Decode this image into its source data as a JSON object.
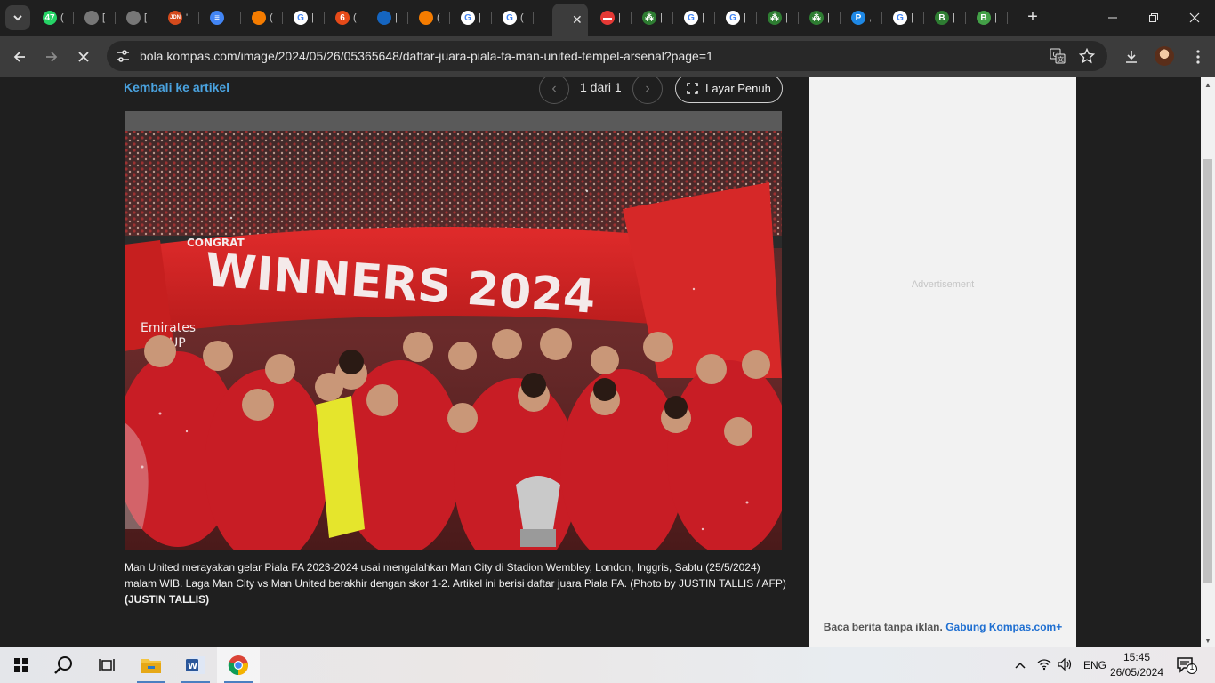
{
  "browser": {
    "tabs": [
      {
        "favicon": "whatsapp",
        "color": "#25d366",
        "glyph": "47",
        "title": "("
      },
      {
        "favicon": "globe",
        "color": "#777777",
        "glyph": "",
        "title": "["
      },
      {
        "favicon": "globe",
        "color": "#777777",
        "glyph": "",
        "title": "["
      },
      {
        "favicon": "news",
        "color": "#d44a1c",
        "glyph": "JDN",
        "title": "'"
      },
      {
        "favicon": "docs",
        "color": "#4285f4",
        "glyph": "≡",
        "title": "|"
      },
      {
        "favicon": "kompas",
        "color": "#f57c00",
        "glyph": "",
        "title": "("
      },
      {
        "favicon": "google",
        "color": "#ffffff",
        "glyph": "G",
        "title": "|"
      },
      {
        "favicon": "six",
        "color": "#e64a19",
        "glyph": "6",
        "title": "("
      },
      {
        "favicon": "bola",
        "color": "#1565c0",
        "glyph": "",
        "title": "|"
      },
      {
        "favicon": "kompas",
        "color": "#f57c00",
        "glyph": "",
        "title": "("
      },
      {
        "favicon": "google",
        "color": "#ffffff",
        "glyph": "G",
        "title": "|"
      },
      {
        "favicon": "google",
        "color": "#ffffff",
        "glyph": "G",
        "title": "("
      }
    ],
    "active_tab": {
      "title": "("
    },
    "tabs_after": [
      {
        "favicon": "badge",
        "color": "#e53935",
        "glyph": "▬",
        "title": "|"
      },
      {
        "favicon": "runner",
        "color": "#2e7d32",
        "glyph": "⁂",
        "title": "|"
      },
      {
        "favicon": "google",
        "color": "#ffffff",
        "glyph": "G",
        "title": "|"
      },
      {
        "favicon": "google",
        "color": "#ffffff",
        "glyph": "G",
        "title": "|"
      },
      {
        "favicon": "runner",
        "color": "#2e7d32",
        "glyph": "⁂",
        "title": "|"
      },
      {
        "favicon": "runner",
        "color": "#2e7d32",
        "glyph": "⁂",
        "title": "|"
      },
      {
        "favicon": "p",
        "color": "#1e88e5",
        "glyph": "P",
        "title": ","
      },
      {
        "favicon": "google",
        "color": "#ffffff",
        "glyph": "G",
        "title": "|"
      },
      {
        "favicon": "b",
        "color": "#2e7d32",
        "glyph": "B",
        "title": "|"
      },
      {
        "favicon": "b",
        "color": "#43a047",
        "glyph": "B",
        "title": "|"
      }
    ],
    "url": "bola.kompas.com/image/2024/05/26/05365648/daftar-juara-piala-fa-man-united-tempel-arsenal?page=1"
  },
  "page": {
    "back_link": "Kembali ke artikel",
    "counter": "1 dari 1",
    "fullscreen_label": "Layar Penuh",
    "photo": {
      "banner_text": "WINNERS 2024",
      "congrats_text": "CONGRAT",
      "emirates_text": "Emirates",
      "cup_text": "UP"
    },
    "caption": "Man United merayakan gelar Piala FA 2023-2024 usai mengalahkan Man City di Stadion Wembley, London, Inggris, Sabtu (25/5/2024) malam WIB. Laga Man City vs Man United berakhir dengan skor 1-2. Artikel ini berisi daftar juara Piala FA. (Photo by JUSTIN TALLIS / AFP)",
    "caption_credit": "(JUSTIN TALLIS)",
    "ad": {
      "label": "Advertisement",
      "promo_text": "Baca berita tanpa iklan.",
      "promo_link": "Gabung Kompas.com+"
    }
  },
  "taskbar": {
    "language": "ENG",
    "time": "15:45",
    "date": "26/05/2024",
    "notification_count": "1"
  }
}
